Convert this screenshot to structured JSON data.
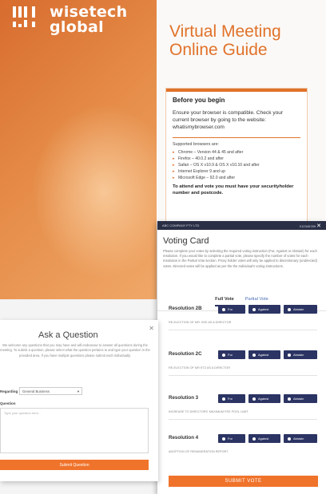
{
  "brand": {
    "line1": "wisetech",
    "line2": "global",
    "accent": "#e0722a"
  },
  "guide": {
    "title_line1": "Virtual Meeting",
    "title_line2": "Online Guide",
    "heading": "Before you begin",
    "para": "Ensure your browser is compatible. Check your current browser by going to the website: whatismybrowser.com",
    "supported_label": "Supported browsers are:",
    "browsers": [
      "Chrome – Version 44 & 45 and after",
      "Firefox – 40.0.2 and after",
      "Safari – OS X v10.9 & OS X v10.10 and after",
      "Internet Explorer 9 and up",
      "Microsoft Edge – 92.0 and after"
    ],
    "note": "To attend and vote you must have your securityholder number and postcode."
  },
  "voting": {
    "top_left": "ABC COMPANY PTY LTD",
    "top_right": "X12345789",
    "title": "Voting Card",
    "desc": "Please complete your votes by selecting the required voting instruction (For, Against or Abstain) for each resolution. If you would like to complete a partial vote, please specify the number of votes for each resolution in the Partial Vote section. Proxy holder votes will only be applied to discretionary (undirected) votes. Directed votes will be applied as per the the Individual's voting instructions.",
    "tabs": [
      "Full Vote",
      "Partial Vote"
    ],
    "buttons": [
      "For",
      "Against",
      "Abstain"
    ],
    "resolutions": [
      {
        "name": "Resolution 2B",
        "desc": "RE-ELECTION OF MR. KEE AS A DIRECTOR"
      },
      {
        "name": "Resolution 2C",
        "desc": "RE-ELECTION OF MR ETZ AS A DIRECTOR"
      },
      {
        "name": "Resolution 3",
        "desc": "INCREASE TO DIRECTORS' MAXIMUM FEE POOL LIMIT"
      },
      {
        "name": "Resolution 4",
        "desc": "ADOPTION OF REMUNERATION REPORT"
      }
    ],
    "submit": "SUBMIT VOTE"
  },
  "ask": {
    "title": "Ask a Question",
    "desc": "We welcome any questions that you may have and will endeavour to answer all questions during the meeting. To submit a question, please select what the question pertains to and type your question in the provided area. If you have multiple questions please submit each individually.",
    "regarding_label": "Regarding",
    "regarding_value": "General Business",
    "question_label": "Question",
    "placeholder": "Type your question here...",
    "submit": "Submit Question"
  }
}
